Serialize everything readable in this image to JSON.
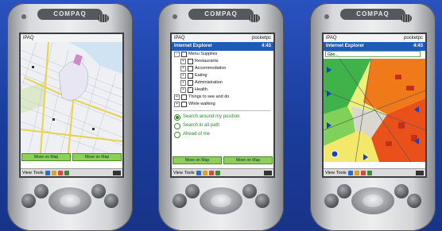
{
  "colors": {
    "background": "#1c3fa0",
    "title_bar": "#1e5bb8",
    "button_green": "#8cd05a",
    "link_green": "#2a8a2a"
  },
  "devices": [
    {
      "brand": "COMPAQ",
      "status_bar": {
        "left": "iPAQ",
        "right": ""
      },
      "buttons": [
        "Move on Map",
        "Move on Map"
      ],
      "taskbar": {
        "menu": "View",
        "menu2": "Tools"
      }
    },
    {
      "brand": "COMPAQ",
      "status_bar": {
        "left": "iPAQ",
        "right": "pocketpc"
      },
      "app_title": "Internet Explorer",
      "app_time": "4:43",
      "tree": [
        {
          "label": "Menu Supplies",
          "level": 0,
          "type": "check"
        },
        {
          "label": "Restaurants",
          "level": 1,
          "type": "check"
        },
        {
          "label": "Accommodation",
          "level": 1,
          "type": "check"
        },
        {
          "label": "Eating",
          "level": 1,
          "type": "check"
        },
        {
          "label": "Administration",
          "level": 1,
          "type": "check"
        },
        {
          "label": "Health",
          "level": 1,
          "type": "check"
        },
        {
          "label": "Things to see and do",
          "level": 0,
          "type": "check"
        },
        {
          "label": "While walking",
          "level": 0,
          "type": "check"
        }
      ],
      "options": [
        {
          "label": "Search around my position",
          "selected": true
        },
        {
          "label": "Search in all path",
          "selected": false
        },
        {
          "label": "Ahead of me",
          "selected": false
        }
      ],
      "buttons": [
        "Move on Map",
        "Move on Map"
      ],
      "taskbar": {
        "menu": "View",
        "menu2": "Tools"
      }
    },
    {
      "brand": "COMPAQ",
      "status_bar": {
        "left": "iPAQ",
        "right": "pocketpc"
      },
      "app_title": "Internet Explorer",
      "app_time": "4:43",
      "combo": "Gbo...",
      "taskbar": {
        "menu": "View",
        "menu2": "Tools"
      }
    }
  ]
}
